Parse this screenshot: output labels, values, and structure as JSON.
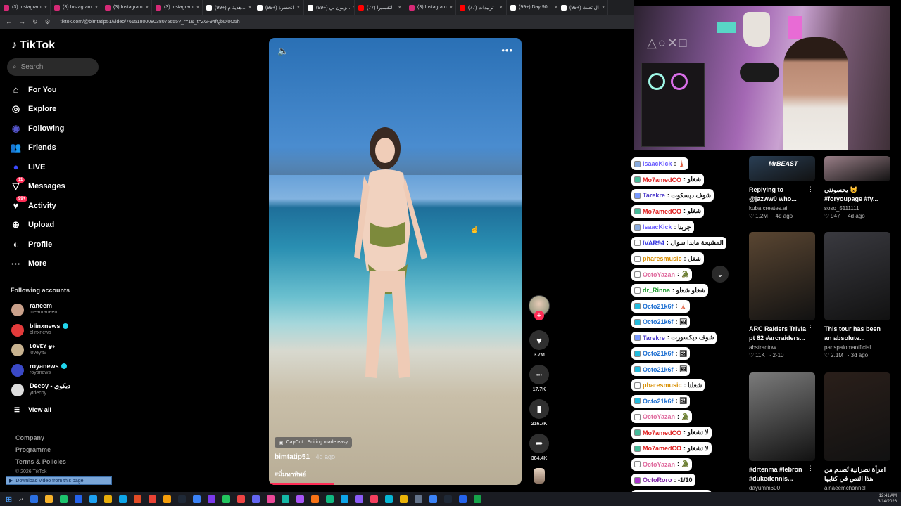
{
  "browser": {
    "tabs": [
      {
        "label": "(3) Instagram",
        "color": "#d62976"
      },
      {
        "label": "(3) Instagram",
        "color": "#d62976"
      },
      {
        "label": "(3) Instagram",
        "color": "#d62976"
      },
      {
        "label": "(3) Instagram",
        "color": "#d62976"
      },
      {
        "label": "(99+) هدية م...",
        "color": "#ffffff"
      },
      {
        "label": "(99+) انحضرة",
        "color": "#ffffff"
      },
      {
        "label": "(99+) زبون لي...",
        "color": "#ffffff"
      },
      {
        "label": "(77) التفسيرا",
        "color": "#ff0000"
      },
      {
        "label": "(3) Instagram",
        "color": "#d62976"
      },
      {
        "label": "(77) ترنيدات",
        "color": "#ff0000"
      },
      {
        "label": "(99+) Day 90...",
        "color": "#ffffff"
      },
      {
        "label": "(99+) ال تعبث",
        "color": "#ffffff"
      }
    ],
    "url": "tiktok.com/@bimtatip51/video/7615180008038075655?_r=1&_t=ZG-94fQbDi0O5h"
  },
  "sidebar": {
    "logo": "TikTok",
    "search_placeholder": "Search",
    "nav": [
      {
        "label": "For You",
        "icon": "home-icon"
      },
      {
        "label": "Explore",
        "icon": "compass-icon"
      },
      {
        "label": "Following",
        "icon": "following-icon"
      },
      {
        "label": "Friends",
        "icon": "friends-icon"
      },
      {
        "label": "LIVE",
        "icon": "live-icon"
      },
      {
        "label": "Messages",
        "icon": "messages-icon",
        "badge": "11"
      },
      {
        "label": "Activity",
        "icon": "activity-icon",
        "badge": "99+"
      },
      {
        "label": "Upload",
        "icon": "upload-icon"
      },
      {
        "label": "Profile",
        "icon": "profile-icon"
      },
      {
        "label": "More",
        "icon": "more-icon"
      }
    ],
    "following_title": "Following accounts",
    "accounts": [
      {
        "name": "raneem",
        "handle": "meanraneem",
        "verified": false,
        "color": "#c9a08a"
      },
      {
        "name": "blinxnews",
        "handle": "blinxnews",
        "verified": true,
        "color": "#e33b3b"
      },
      {
        "name": "ʟᴏᴠᴇʏ 𝓎𝓇",
        "handle": "l0veyttv",
        "verified": false,
        "color": "#c7b28f"
      },
      {
        "name": "royanews",
        "handle": "royanews",
        "verified": true,
        "color": "#3b49c7"
      },
      {
        "name": "Decoy - ديكوي",
        "handle": "ytdecoy",
        "verified": false,
        "color": "#dddddd"
      }
    ],
    "view_all": "View all",
    "footer": [
      "Company",
      "Programme",
      "Terms & Policies"
    ],
    "copyright": "© 2026 TikTok",
    "download_bar": "Download video from this page"
  },
  "video": {
    "capcut_label": "CapCut · Editing made easy",
    "author": "bimtatip51",
    "age": "· 4d ago",
    "hashtag": "#มิ่มทาทิพย์",
    "progress_pct": 26,
    "actions": [
      {
        "name": "like",
        "icon": "heart-icon",
        "glyph": "♥",
        "count": "3.7M"
      },
      {
        "name": "comment",
        "icon": "comment-icon",
        "glyph": "•••",
        "count": "17.7K"
      },
      {
        "name": "save",
        "icon": "bookmark-icon",
        "glyph": "▮",
        "count": "216.7K"
      },
      {
        "name": "share",
        "icon": "share-icon",
        "glyph": "➦",
        "count": "384.4K"
      }
    ]
  },
  "chat": [
    {
      "user": "IsaacKick",
      "text": ": 🗼",
      "color": "#6a5cff",
      "badge": "#8ad"
    },
    {
      "user": "Mo7amedCO",
      "text": ": شغلو",
      "color": "#e01e1e",
      "badge": "#4b9"
    },
    {
      "user": "Tarekre",
      "text": ": شوف ديسكوت",
      "color": "#4a37c9",
      "badge": "#79f"
    },
    {
      "user": "Mo7amedCO",
      "text": ": شغلو",
      "color": "#e01e1e",
      "badge": "#4b9"
    },
    {
      "user": "IsaacKick",
      "text": ": جربنا",
      "color": "#6a5cff",
      "badge": "#8ad"
    },
    {
      "user": "IVAR94",
      "text": ": المشيحة مابدا سوال",
      "color": "#3b3be0",
      "badge": "#fff"
    },
    {
      "user": "pharesmusic",
      "text": ": شغل",
      "color": "#d88e00",
      "badge": "#fff"
    },
    {
      "user": "OctoYazan",
      "text": ": 🐊",
      "color": "#e06a9e",
      "badge": "#fff"
    },
    {
      "user": "dr_Rinna",
      "text": ": شغلو شغلو",
      "color": "#1a9a2a",
      "badge": "#fff"
    },
    {
      "user": "Octo21k6f",
      "text": ": 🗼",
      "color": "#1d6fd1",
      "badge": "#2bd"
    },
    {
      "user": "Octo21k6f",
      "text": ": 🖼",
      "color": "#1d6fd1",
      "badge": "#2bd"
    },
    {
      "user": "Tarekre",
      "text": ": شوف ديكسورت",
      "color": "#4a37c9",
      "badge": "#79f"
    },
    {
      "user": "Octo21k6f",
      "text": ": 🖼",
      "color": "#1d6fd1",
      "badge": "#2bd"
    },
    {
      "user": "Octo21k6f",
      "text": ": 🖼",
      "color": "#1d6fd1",
      "badge": "#2bd"
    },
    {
      "user": "pharesmusic",
      "text": ": شغلنا",
      "color": "#d88e00",
      "badge": "#fff"
    },
    {
      "user": "Octo21k6f",
      "text": ": 🖼",
      "color": "#1d6fd1",
      "badge": "#2bd"
    },
    {
      "user": "OctoYazan",
      "text": ": 🐊",
      "color": "#e06a9e",
      "badge": "#fff"
    },
    {
      "user": "Mo7amedCO",
      "text": ": لا تشغلو",
      "color": "#e01e1e",
      "badge": "#4b9"
    },
    {
      "user": "Mo7amedCO",
      "text": ": لا تشغلو",
      "color": "#e01e1e",
      "badge": "#4b9"
    },
    {
      "user": "OctoYazan",
      "text": ": 🐊",
      "color": "#e06a9e",
      "badge": "#fff"
    },
    {
      "user": "OctoRoro",
      "text": ": -1/10",
      "color": "#7a1fa2",
      "badge": "#a3c"
    },
    {
      "user": "Mo7amedCO",
      "text": ": لا تشغلو",
      "color": "#e01e1e",
      "badge": "#4b9"
    }
  ],
  "recommended": [
    {
      "caption": "Replying to",
      "caption2": "@jazww0 who...",
      "author": "kuba.creates.ai",
      "likes": "1.2M",
      "age": "4d ago",
      "thumb": "#2a3f55"
    },
    {
      "caption": "يحسونتي 😺",
      "caption2": "#foryoupage #fy...",
      "author": "soso_5111111",
      "likes": "947",
      "age": "4d ago",
      "thumb": "#9a7f88"
    },
    {
      "caption": "ARC Raiders Trivia",
      "caption2": "pt 82 #arcraiders...",
      "author": "abstractow",
      "likes": "11K",
      "age": "2-10",
      "thumb": "#5a4632"
    },
    {
      "caption": "This tour has been",
      "caption2": "an absolute...",
      "author": "parispalomaofficial",
      "likes": "2.1M",
      "age": "3d ago",
      "thumb": "#3a3a40"
    },
    {
      "caption": "#drtenma #lebron",
      "caption2": "#dukedennis...",
      "author": "dayumm600",
      "likes": "",
      "age": "",
      "thumb": "#7b7b7b"
    },
    {
      "caption": "امرأة نصرانية تُصدم من",
      "caption2": "هذا النص في كتابها",
      "author": "alnaeemchannel",
      "likes": "",
      "age": "",
      "thumb": "#2a1f1a"
    }
  ],
  "rec_top_labels": [
    "MrBEAST"
  ],
  "taskbar": {
    "time": "12:41 AM",
    "date": "3/14/2026",
    "icons": [
      "#2b6fe0",
      "#f7b32b",
      "#1dc36d",
      "#2563eb",
      "#1da1f2",
      "#e8ad0a",
      "#0ea5e9",
      "#e34c26",
      "#ea4335",
      "#f59e0b",
      "#1f2937",
      "#3b82f6",
      "#7c3aed",
      "#22c55e",
      "#ef4444",
      "#6366f1",
      "#ec4899",
      "#14b8a6",
      "#a855f7",
      "#f97316",
      "#10b981",
      "#0ea5e9",
      "#8b5cf6",
      "#f43f5e",
      "#06b6d4",
      "#eab308",
      "#64748b",
      "#3b82f6",
      "#1f2937",
      "#2563eb",
      "#16a34a"
    ]
  }
}
